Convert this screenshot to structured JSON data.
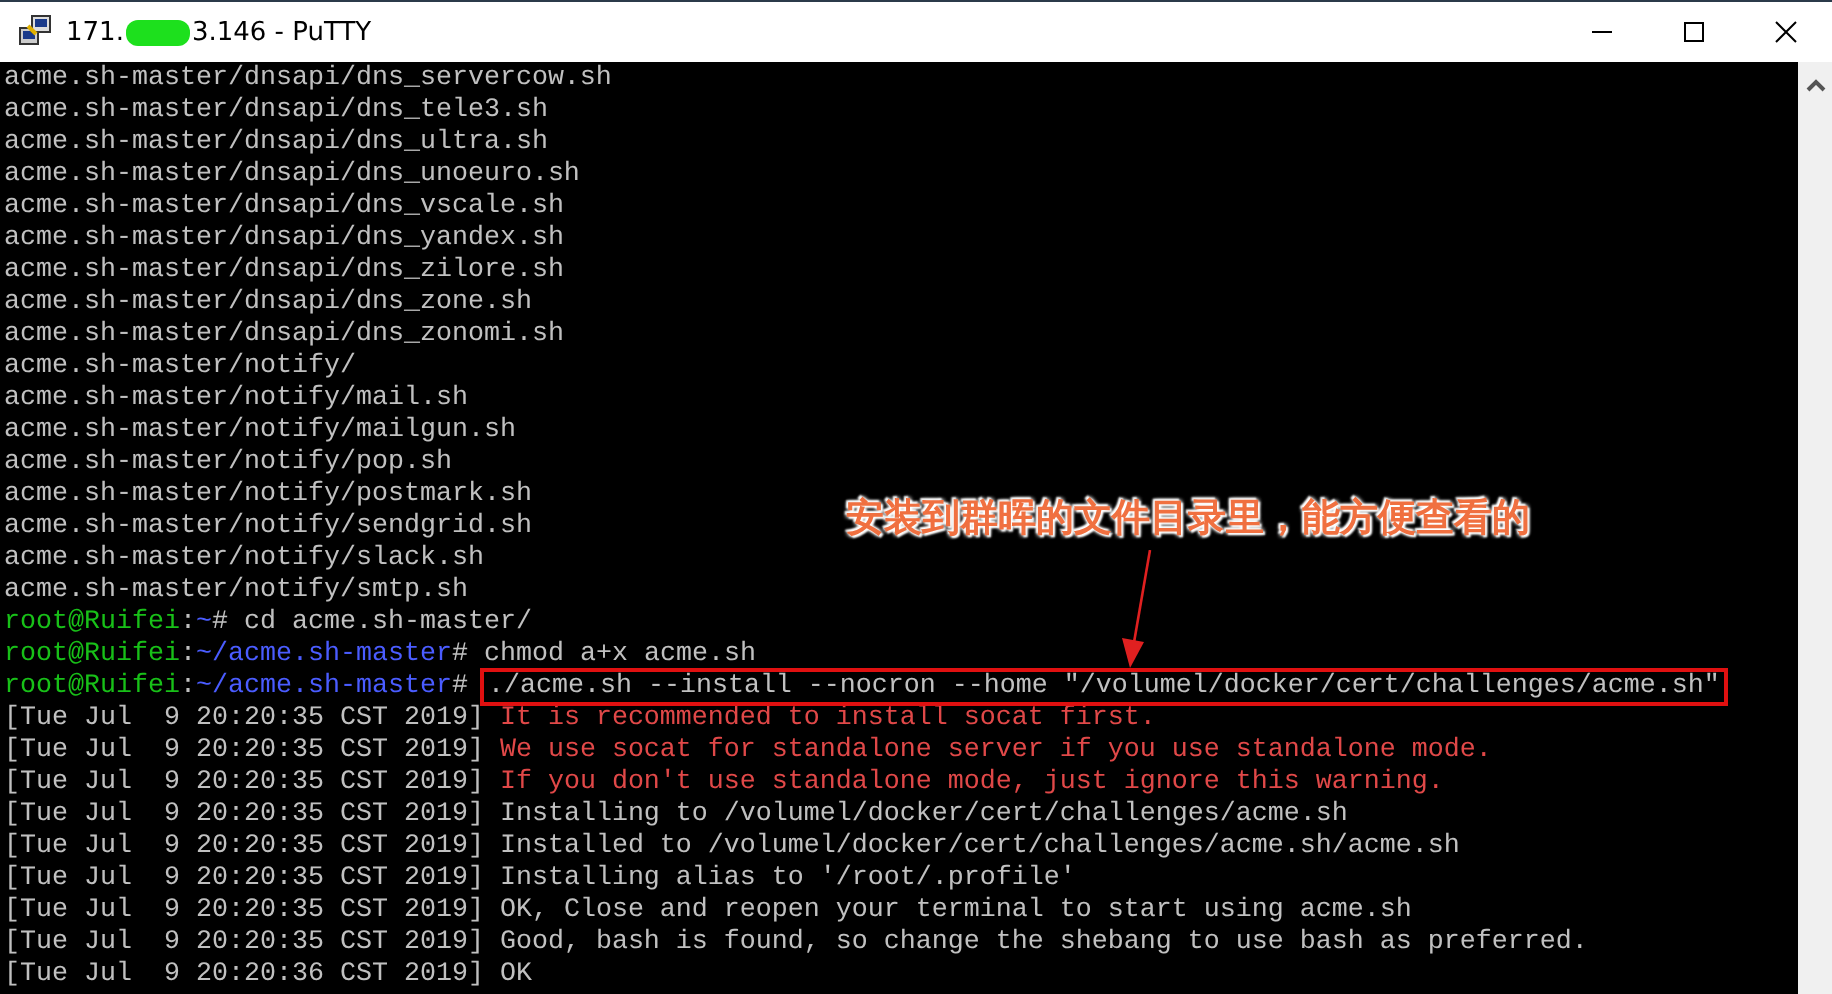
{
  "window": {
    "title_start": "171.",
    "title_redacted": true,
    "title_end": "3.146 - PuTTY"
  },
  "terminal": {
    "lines": [
      {
        "kind": "plain",
        "text": "acme.sh-master/dnsapi/dns_servercow.sh"
      },
      {
        "kind": "plain",
        "text": "acme.sh-master/dnsapi/dns_tele3.sh"
      },
      {
        "kind": "plain",
        "text": "acme.sh-master/dnsapi/dns_ultra.sh"
      },
      {
        "kind": "plain",
        "text": "acme.sh-master/dnsapi/dns_unoeuro.sh"
      },
      {
        "kind": "plain",
        "text": "acme.sh-master/dnsapi/dns_vscale.sh"
      },
      {
        "kind": "plain",
        "text": "acme.sh-master/dnsapi/dns_yandex.sh"
      },
      {
        "kind": "plain",
        "text": "acme.sh-master/dnsapi/dns_zilore.sh"
      },
      {
        "kind": "plain",
        "text": "acme.sh-master/dnsapi/dns_zone.sh"
      },
      {
        "kind": "plain",
        "text": "acme.sh-master/dnsapi/dns_zonomi.sh"
      },
      {
        "kind": "plain",
        "text": "acme.sh-master/notify/"
      },
      {
        "kind": "plain",
        "text": "acme.sh-master/notify/mail.sh"
      },
      {
        "kind": "plain",
        "text": "acme.sh-master/notify/mailgun.sh"
      },
      {
        "kind": "plain",
        "text": "acme.sh-master/notify/pop.sh"
      },
      {
        "kind": "plain",
        "text": "acme.sh-master/notify/postmark.sh"
      },
      {
        "kind": "plain",
        "text": "acme.sh-master/notify/sendgrid.sh"
      },
      {
        "kind": "plain",
        "text": "acme.sh-master/notify/slack.sh"
      },
      {
        "kind": "plain",
        "text": "acme.sh-master/notify/smtp.sh"
      },
      {
        "kind": "prompt",
        "user": "root@Ruifei",
        "sep": ":",
        "path": "~",
        "symbol": "#",
        "command": "cd acme.sh-master/",
        "highlighted": false
      },
      {
        "kind": "prompt",
        "user": "root@Ruifei",
        "sep": ":",
        "path": "~/acme.sh-master",
        "symbol": "#",
        "command": "chmod a+x acme.sh",
        "highlighted": false
      },
      {
        "kind": "prompt",
        "user": "root@Ruifei",
        "sep": ":",
        "path": "~/acme.sh-master",
        "symbol": "#",
        "command": "./acme.sh --install --nocron --home \"/volumel/docker/cert/challenges/acme.sh\"",
        "highlighted": true
      },
      {
        "kind": "log",
        "time": "[Tue Jul  9 20:20:35 CST 2019]",
        "message": "It is recommended to install socat first.",
        "warning": true
      },
      {
        "kind": "log",
        "time": "[Tue Jul  9 20:20:35 CST 2019]",
        "message": "We use socat for standalone server if you use standalone mode.",
        "warning": true
      },
      {
        "kind": "log",
        "time": "[Tue Jul  9 20:20:35 CST 2019]",
        "message": "If you don't use standalone mode, just ignore this warning.",
        "warning": true
      },
      {
        "kind": "log",
        "time": "[Tue Jul  9 20:20:35 CST 2019]",
        "message": "Installing to /volumel/docker/cert/challenges/acme.sh",
        "warning": false
      },
      {
        "kind": "log",
        "time": "[Tue Jul  9 20:20:35 CST 2019]",
        "message": "Installed to /volumel/docker/cert/challenges/acme.sh/acme.sh",
        "warning": false
      },
      {
        "kind": "log",
        "time": "[Tue Jul  9 20:20:35 CST 2019]",
        "message": "Installing alias to '/root/.profile'",
        "warning": false
      },
      {
        "kind": "log",
        "time": "[Tue Jul  9 20:20:35 CST 2019]",
        "message": "OK, Close and reopen your terminal to start using acme.sh",
        "warning": false
      },
      {
        "kind": "log",
        "time": "[Tue Jul  9 20:20:35 CST 2019]",
        "message": "Good, bash is found, so change the shebang to use bash as preferred.",
        "warning": false
      },
      {
        "kind": "log",
        "time": "[Tue Jul  9 20:20:36 CST 2019]",
        "message": "OK",
        "warning": false
      }
    ]
  },
  "annotation": {
    "text": "安装到群晖的文件目录里，能方便查看的"
  }
}
